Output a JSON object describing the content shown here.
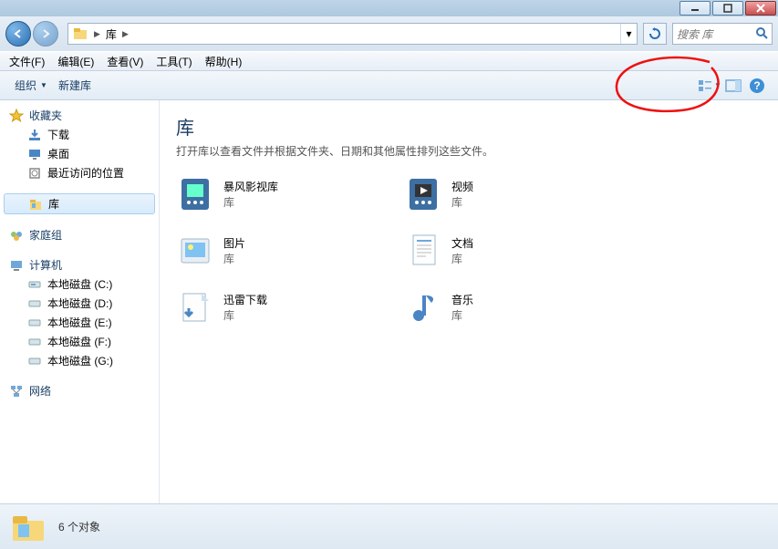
{
  "titlebar": {},
  "address": {
    "root": "库",
    "search_placeholder": "搜索 库"
  },
  "menus": {
    "file": "文件(F)",
    "edit": "编辑(E)",
    "view": "查看(V)",
    "tools": "工具(T)",
    "help": "帮助(H)"
  },
  "toolbar": {
    "organize": "组织",
    "newlib": "新建库"
  },
  "sidebar": {
    "favorites": {
      "label": "收藏夹",
      "items": [
        "下载",
        "桌面",
        "最近访问的位置"
      ]
    },
    "libraries": {
      "label": "库"
    },
    "homegroup": {
      "label": "家庭组"
    },
    "computer": {
      "label": "计算机",
      "drives": [
        "本地磁盘 (C:)",
        "本地磁盘 (D:)",
        "本地磁盘 (E:)",
        "本地磁盘 (F:)",
        "本地磁盘 (G:)"
      ]
    },
    "network": {
      "label": "网络"
    }
  },
  "content": {
    "title": "库",
    "subtitle": "打开库以查看文件并根据文件夹、日期和其他属性排列这些文件。",
    "libtype": "库",
    "items": [
      {
        "name": "暴风影视库"
      },
      {
        "name": "视频"
      },
      {
        "name": "图片"
      },
      {
        "name": "文档"
      },
      {
        "name": "迅雷下载"
      },
      {
        "name": "音乐"
      }
    ]
  },
  "status": {
    "count": "6 个对象"
  }
}
